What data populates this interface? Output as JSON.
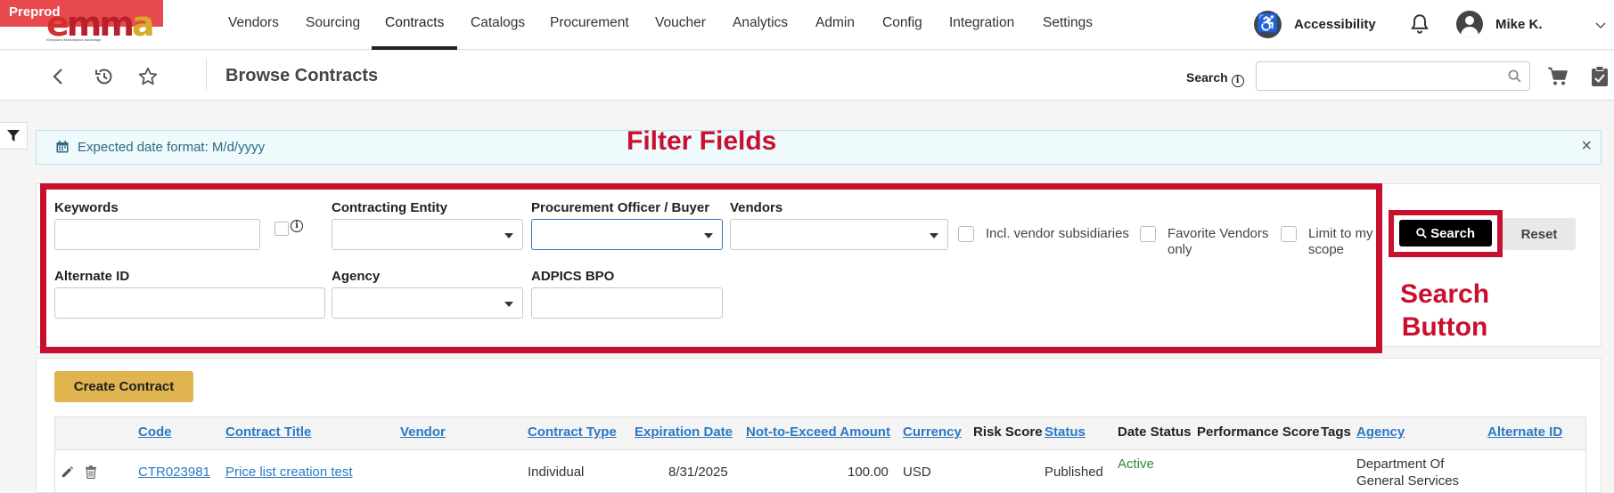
{
  "env_badge": "Preprod",
  "logo": {
    "text_e": "e",
    "text_mm": "mm",
    "text_a": "a",
    "tagline": "eMaryland Marketplace Advantage"
  },
  "nav": {
    "items": [
      "Vendors",
      "Sourcing",
      "Contracts",
      "Catalogs",
      "Procurement",
      "Voucher",
      "Analytics",
      "Admin",
      "Config",
      "Integration",
      "Settings"
    ],
    "active": "Contracts",
    "accessibility_label": "Accessibility",
    "user_name": "Mike K."
  },
  "subbar": {
    "page_title": "Browse Contracts",
    "search_label": "Search",
    "search_value": ""
  },
  "banner": {
    "text": "Expected date format: M/d/yyyy",
    "close": "×"
  },
  "annotations": {
    "filter_fields": "Filter Fields",
    "search_button_line1": "Search",
    "search_button_line2": "Button"
  },
  "filters": {
    "keywords_label": "Keywords",
    "keywords_value": "",
    "contracting_entity_label": "Contracting Entity",
    "procurement_officer_label": "Procurement Officer / Buyer",
    "vendors_label": "Vendors",
    "incl_vendor_subsidiaries": "Incl. vendor subsidiaries",
    "favorite_vendors_line1": "Favorite Vendors",
    "favorite_vendors_line2": "only",
    "limit_scope_line1": "Limit to my",
    "limit_scope_line2": "scope",
    "alternate_id_label": "Alternate ID",
    "agency_label": "Agency",
    "adpics_bpo_label": "ADPICS BPO",
    "search_button": "Search",
    "reset_button": "Reset"
  },
  "actions": {
    "create_contract": "Create Contract"
  },
  "table": {
    "columns": [
      "Code",
      "Contract Title",
      "Vendor",
      "Contract Type",
      "Expiration Date",
      "Not-to-Exceed Amount",
      "Currency",
      "Risk Score",
      "Status",
      "Date Status",
      "Performance Score",
      "Tags",
      "Agency",
      "Alternate ID"
    ],
    "rows": [
      {
        "code": "CTR023981",
        "title": "Price list creation test",
        "vendor": "",
        "type": "Individual",
        "expiration": "8/31/2025",
        "amount": "100.00",
        "currency": "USD",
        "risk_score": "",
        "status": "Published",
        "date_status": "Active",
        "performance_score": "",
        "tags": "",
        "agency_line1": "Department Of",
        "agency_line2": "General Services",
        "alternate_id": ""
      }
    ]
  },
  "colors": {
    "brand_red": "#c8102e",
    "link_blue": "#2a79c4",
    "create_button": "#e0b44f",
    "active_green": "#2e8b2e",
    "banner_bg": "#eefafc"
  }
}
